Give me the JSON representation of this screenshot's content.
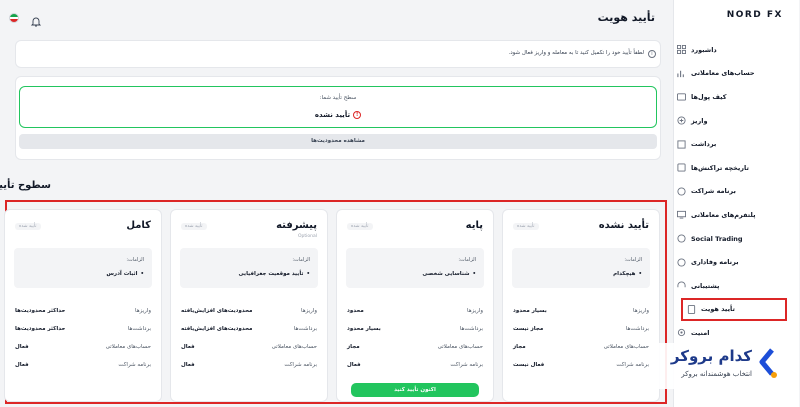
{
  "sidebar": {
    "logo": "NORD FX",
    "items": [
      {
        "label": "داشبورد",
        "icon": "dashboard-icon"
      },
      {
        "label": "حساب‌های معاملاتی",
        "icon": "chart-icon"
      },
      {
        "label": "کیف پول‌ها",
        "icon": "wallet-icon"
      },
      {
        "label": "واریز",
        "icon": "deposit-icon"
      },
      {
        "label": "برداشت",
        "icon": "withdraw-icon"
      },
      {
        "label": "تاریخچه تراکنش‌ها",
        "icon": "history-icon"
      },
      {
        "label": "برنامه شراکت",
        "icon": "partnership-icon"
      },
      {
        "label": "پلتفرم‌های معاملاتی",
        "icon": "platform-icon"
      },
      {
        "label": "Social Trading",
        "icon": "social-icon"
      },
      {
        "label": "برنامه وفاداری",
        "icon": "loyalty-icon"
      },
      {
        "label": "پشتیبانی",
        "icon": "support-icon"
      },
      {
        "label": "تأیید هویت",
        "icon": "identity-icon"
      },
      {
        "label": "امنیت",
        "icon": "security-icon"
      }
    ]
  },
  "header": {
    "title": "تأیید هویت"
  },
  "alert": {
    "text": "لطفاً تأیید خود را تکمیل کنید تا به معامله و واریز فعال شود."
  },
  "status": {
    "label": "سطح تأیید شما:",
    "value": "تأیید نشده",
    "view_limits": "مشاهده محدودیت‌ها"
  },
  "levels_title": "سطوح تأیید",
  "levels": [
    {
      "title": "تأیید نشده",
      "subtitle": "",
      "badge": "تأیید شده",
      "req_label": "الزامات:",
      "req_item": "هیچکدام",
      "rows": [
        {
          "k": "واریزها",
          "v": "بسیار محدود"
        },
        {
          "k": "برداشت‌ها",
          "v": "مجاز نیست"
        },
        {
          "k": "حساب‌های معاملاتی",
          "v": "مجاز"
        },
        {
          "k": "برنامه شراکت",
          "v": "فعال نیست"
        }
      ]
    },
    {
      "title": "پایه",
      "subtitle": "",
      "badge": "تأیید شده",
      "req_label": "الزامات:",
      "req_item": "شناسایی شخصی",
      "rows": [
        {
          "k": "واریزها",
          "v": "محدود"
        },
        {
          "k": "برداشت‌ها",
          "v": "بسیار محدود"
        },
        {
          "k": "حساب‌های معاملاتی",
          "v": "مجاز"
        },
        {
          "k": "برنامه شراکت",
          "v": "فعال"
        }
      ],
      "button": "اکنون تأیید کنید"
    },
    {
      "title": "پیشرفته",
      "subtitle": "Optional",
      "badge": "تأیید شده",
      "req_label": "الزامات:",
      "req_item": "تأیید موقعیت جغرافیایی",
      "rows": [
        {
          "k": "واریزها",
          "v": "محدودیت‌های افزایش‌یافته"
        },
        {
          "k": "برداشت‌ها",
          "v": "محدودیت‌های افزایش‌یافته"
        },
        {
          "k": "حساب‌های معاملاتی",
          "v": "فعال"
        },
        {
          "k": "برنامه شراکت",
          "v": "فعال"
        }
      ]
    },
    {
      "title": "کامل",
      "subtitle": "",
      "badge": "تأیید شده",
      "req_label": "الزامات:",
      "req_item": "اثبات آدرس",
      "rows": [
        {
          "k": "واریزها",
          "v": "حداکثر محدودیت‌ها"
        },
        {
          "k": "برداشت‌ها",
          "v": "حداکثر محدودیت‌ها"
        },
        {
          "k": "حساب‌های معاملاتی",
          "v": "فعال"
        },
        {
          "k": "برنامه شراکت",
          "v": "فعال"
        }
      ]
    }
  ],
  "watermark": {
    "title": "کدام بروکر",
    "subtitle": "انتخاب هوشمندانه بروکر"
  },
  "colors": {
    "accent_green": "#22c55e",
    "highlight_red": "#dc2626",
    "brand_navy": "#1e3a8a"
  }
}
